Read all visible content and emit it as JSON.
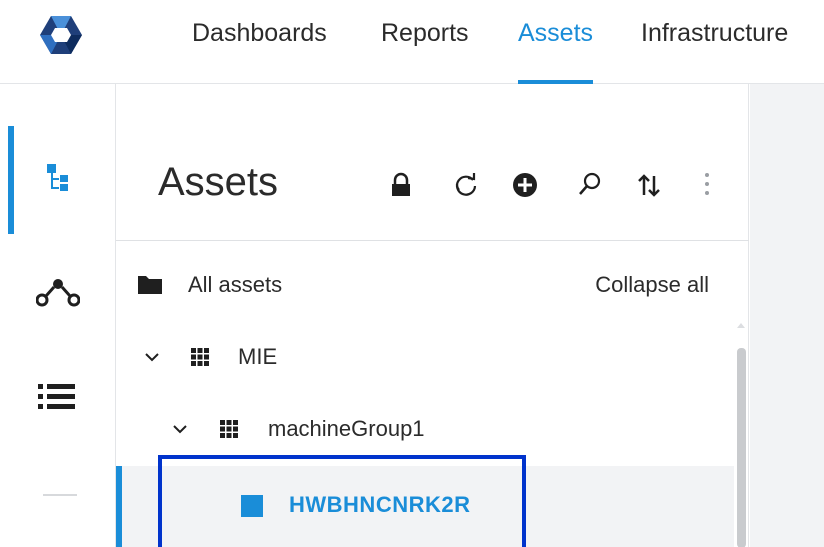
{
  "nav": {
    "items": [
      {
        "label": "Dashboards",
        "active": false
      },
      {
        "label": "Reports",
        "active": false
      },
      {
        "label": "Assets",
        "active": true
      },
      {
        "label": "Infrastructure",
        "active": false
      }
    ]
  },
  "rail": {
    "items": [
      {
        "icon": "asset-tree-icon",
        "active": true
      },
      {
        "icon": "connections-icon",
        "active": false
      },
      {
        "icon": "list-icon",
        "active": false
      }
    ]
  },
  "panel": {
    "title": "Assets",
    "toolbar": [
      "lock-icon",
      "refresh-icon",
      "add-icon",
      "search-icon",
      "sort-icon",
      "more-vertical-icon"
    ],
    "all_assets_label": "All assets",
    "collapse_all_label": "Collapse all"
  },
  "tree": {
    "rows": [
      {
        "label": "MIE",
        "icon": "grid-icon",
        "expanded": true,
        "level": 0
      },
      {
        "label": "machineGroup1",
        "icon": "grid-icon",
        "expanded": true,
        "level": 1
      },
      {
        "label": "HWBHNCNRK2R",
        "icon": "asset-square-icon",
        "selected": true,
        "level": 2
      }
    ]
  },
  "colors": {
    "accent": "#1a8dd8",
    "highlight_box": "#0033cc",
    "text": "#2b2b2b"
  }
}
